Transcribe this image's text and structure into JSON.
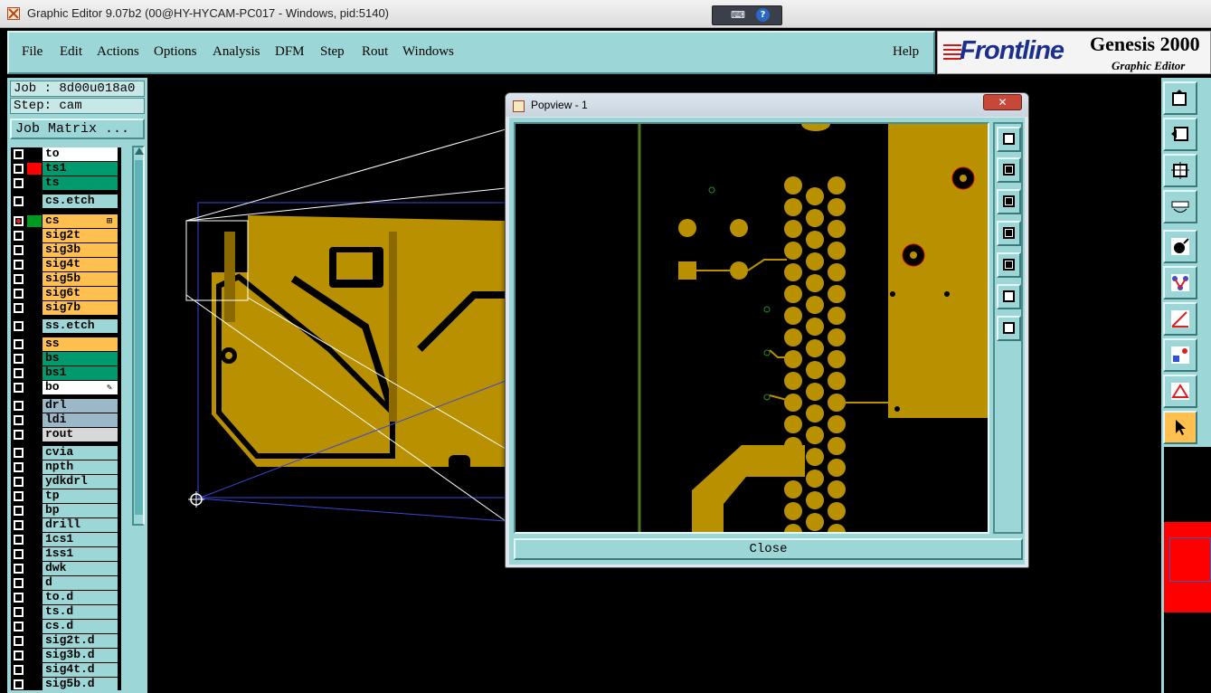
{
  "window": {
    "title": "Graphic Editor 9.07b2 (00@HY-HYCAM-PC017 - Windows, pid:5140)",
    "ime_label": "⌨",
    "ime_help": "?"
  },
  "menu": [
    {
      "label": "File"
    },
    {
      "label": "Edit"
    },
    {
      "label": "Actions"
    },
    {
      "label": "Options"
    },
    {
      "label": "Analysis"
    },
    {
      "label": "DFM"
    },
    {
      "label": "Step"
    },
    {
      "label": "Rout"
    },
    {
      "label": "Windows"
    },
    {
      "label": "Help"
    }
  ],
  "logo": {
    "brand": "Frontline",
    "product": "Genesis 2000",
    "subtitle": "Graphic Editor"
  },
  "job": {
    "job_label": "Job : 8d00u018a0",
    "step_label": "Step: cam",
    "matrix_button": "Job Matrix ..."
  },
  "layers": [
    {
      "name": "to",
      "color": "#ffffff",
      "swatch": "#000000"
    },
    {
      "name": "ts1",
      "color": "#009a6e",
      "swatch": "#ff0000"
    },
    {
      "name": "ts",
      "color": "#009a6e",
      "swatch": "#000000"
    },
    {
      "name": "cs.etch",
      "color": "#9dd6d6",
      "swatch": "#000000"
    },
    {
      "name": "cs",
      "color": "#ffc050",
      "swatch": "#009a20",
      "selected": true,
      "mark": "⊞"
    },
    {
      "name": "sig2t",
      "color": "#ffc050",
      "swatch": "#000000"
    },
    {
      "name": "sig3b",
      "color": "#ffc050",
      "swatch": "#000000"
    },
    {
      "name": "sig4t",
      "color": "#ffc050",
      "swatch": "#000000"
    },
    {
      "name": "sig5b",
      "color": "#ffc050",
      "swatch": "#000000"
    },
    {
      "name": "sig6t",
      "color": "#ffc050",
      "swatch": "#000000"
    },
    {
      "name": "sig7b",
      "color": "#ffc050",
      "swatch": "#000000"
    },
    {
      "name": "ss.etch",
      "color": "#9dd6d6",
      "swatch": "#000000"
    },
    {
      "name": "ss",
      "color": "#ffc050",
      "swatch": "#000000"
    },
    {
      "name": "bs",
      "color": "#009a6e",
      "swatch": "#000000"
    },
    {
      "name": "bs1",
      "color": "#009a6e",
      "swatch": "#000000"
    },
    {
      "name": "bo",
      "color": "#ffffff",
      "swatch": "#000000",
      "mark": "✎"
    },
    {
      "name": "drl",
      "color": "#9ab8c8",
      "swatch": "#000000"
    },
    {
      "name": "ldi",
      "color": "#9ab8c8",
      "swatch": "#000000"
    },
    {
      "name": "rout",
      "color": "#d8d8d8",
      "swatch": "#000000"
    },
    {
      "name": "cvia",
      "color": "#9dd6d6",
      "swatch": "#000000"
    },
    {
      "name": "npth",
      "color": "#9dd6d6",
      "swatch": "#000000"
    },
    {
      "name": "ydkdrl",
      "color": "#9dd6d6",
      "swatch": "#000000"
    },
    {
      "name": "tp",
      "color": "#9dd6d6",
      "swatch": "#000000"
    },
    {
      "name": "bp",
      "color": "#9dd6d6",
      "swatch": "#000000"
    },
    {
      "name": "drill",
      "color": "#9dd6d6",
      "swatch": "#000000"
    },
    {
      "name": "1cs1",
      "color": "#9dd6d6",
      "swatch": "#000000"
    },
    {
      "name": "1ss1",
      "color": "#9dd6d6",
      "swatch": "#000000"
    },
    {
      "name": "dwk",
      "color": "#9dd6d6",
      "swatch": "#000000"
    },
    {
      "name": "d",
      "color": "#9dd6d6",
      "swatch": "#000000"
    },
    {
      "name": "to.d",
      "color": "#9dd6d6",
      "swatch": "#000000"
    },
    {
      "name": "ts.d",
      "color": "#9dd6d6",
      "swatch": "#000000"
    },
    {
      "name": "cs.d",
      "color": "#9dd6d6",
      "swatch": "#000000"
    },
    {
      "name": "sig2t.d",
      "color": "#9dd6d6",
      "swatch": "#000000"
    },
    {
      "name": "sig3b.d",
      "color": "#9dd6d6",
      "swatch": "#000000"
    },
    {
      "name": "sig4t.d",
      "color": "#9dd6d6",
      "swatch": "#000000"
    },
    {
      "name": "sig5b.d",
      "color": "#9dd6d6",
      "swatch": "#000000"
    }
  ],
  "popview": {
    "title": "Popview - 1",
    "close_x": "✕",
    "close_button": "Close",
    "tools": [
      "zoom-window-icon",
      "pan-up-icon",
      "pan-down-icon",
      "pan-left-icon",
      "pan-right-icon",
      "zoom-fit-icon",
      "zoom-center-icon"
    ]
  },
  "colors": {
    "panel": "#9dd6d6",
    "copper": "#b89000",
    "canvas": "#000000"
  },
  "right_tools": [
    "layer-up-icon",
    "layer-left-icon",
    "fit-icon",
    "drill-icon",
    "select-icon",
    "route-icon",
    "line-icon",
    "pad-icon",
    "triangle-icon",
    "pointer-icon"
  ]
}
